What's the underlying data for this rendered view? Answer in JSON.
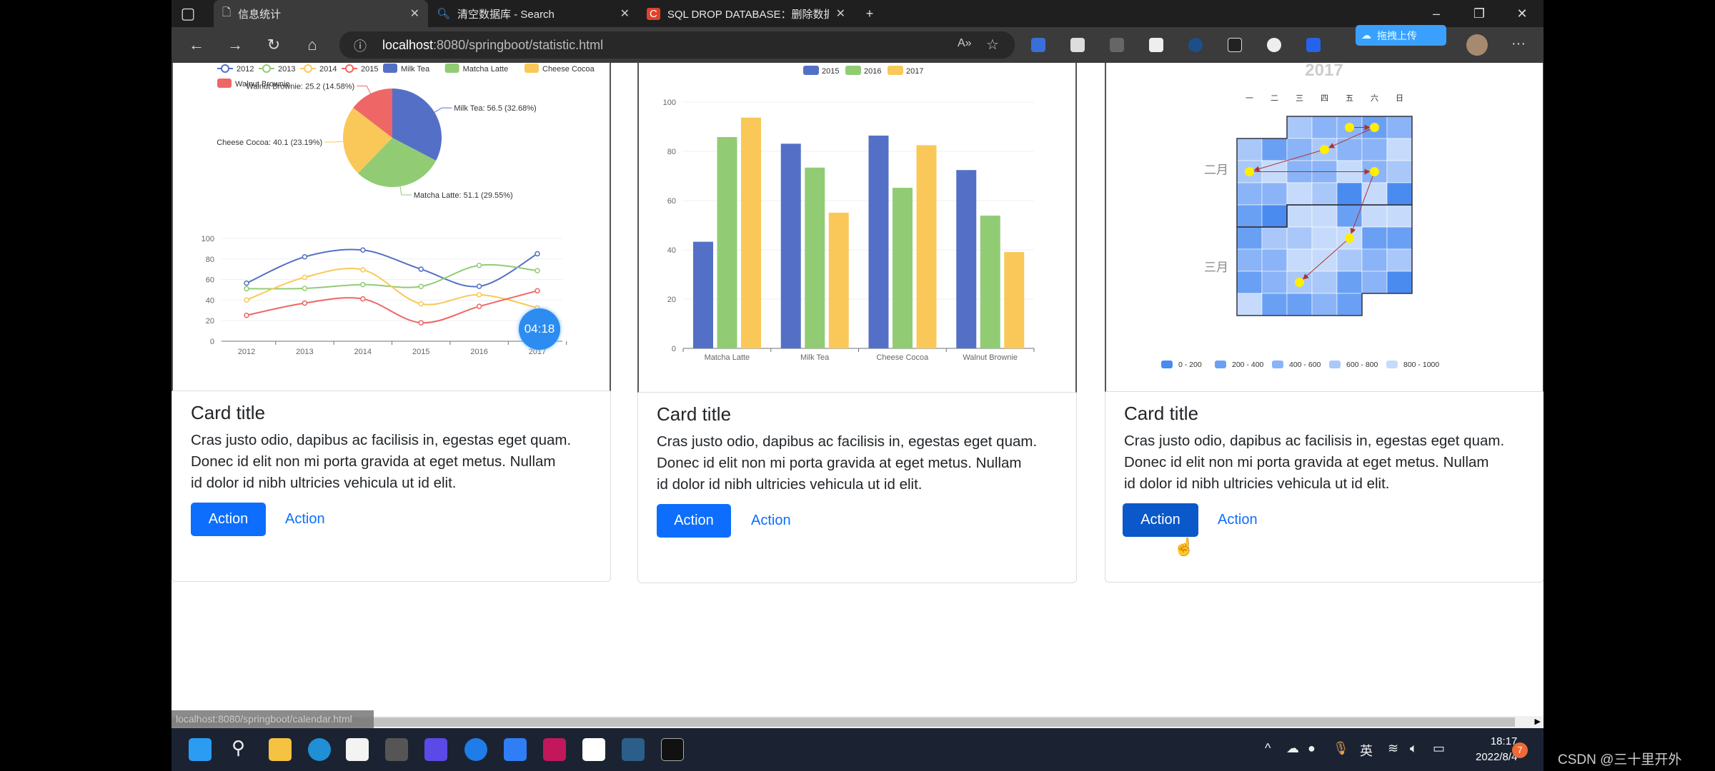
{
  "browser": {
    "tabs": [
      {
        "title": "信息统计",
        "active": true
      },
      {
        "title": "清空数据库 - Search",
        "active": false
      },
      {
        "title": "SQL DROP DATABASE：删除数据",
        "active": false
      }
    ],
    "url_host": "localhost",
    "url_rest": ":8080/springboot/statistic.html",
    "baidu_upload": "拖拽上传",
    "status_url": "localhost:8080/springboot/calendar.html"
  },
  "timer": "04:18",
  "cards": [
    {
      "title": "Card title",
      "text_lines": [
        "Cras justo odio, dapibus ac facilisis in, egestas eget quam.",
        "Donec id elit non mi porta gravida at eget metus. Nullam",
        "id dolor id nibh ultricies vehicula ut id elit."
      ],
      "primary": "Action",
      "link": "Action"
    },
    {
      "title": "Card title",
      "text_lines": [
        "Cras justo odio, dapibus ac facilisis in, egestas eget quam.",
        "Donec id elit non mi porta gravida at eget metus. Nullam",
        "id dolor id nibh ultricies vehicula ut id elit."
      ],
      "primary": "Action",
      "link": "Action"
    },
    {
      "title": "Card title",
      "text_lines": [
        "Cras justo odio, dapibus ac facilisis in, egestas eget quam.",
        "Donec id elit non mi porta gravida at eget metus. Nullam",
        "id dolor id nibh ultricies vehicula ut id elit."
      ],
      "primary": "Action",
      "link": "Action"
    }
  ],
  "chart_data": [
    {
      "type": "pie",
      "legend": [
        "2012",
        "2013",
        "2014",
        "2015",
        "Milk Tea",
        "Matcha Latte",
        "Cheese Cocoa",
        "Walnut Brownie"
      ],
      "categories": [
        "Milk Tea",
        "Matcha Latte",
        "Cheese Cocoa",
        "Walnut Brownie"
      ],
      "values": [
        56.5,
        51.1,
        40.1,
        25.2
      ],
      "labels": [
        "Milk Tea: 56.5 (32.68%)",
        "Matcha Latte: 51.1 (29.55%)",
        "Cheese Cocoa: 40.1 (23.19%)",
        "Walnut Brownie: 25.2 (14.58%)"
      ],
      "colors": [
        "#5470c6",
        "#91cc75",
        "#fac858",
        "#ee6666"
      ]
    },
    {
      "type": "line",
      "x": [
        "2012",
        "2013",
        "2014",
        "2015",
        "2016",
        "2017"
      ],
      "ylim": [
        0,
        100
      ],
      "yticks": [
        "0",
        "20",
        "40",
        "60",
        "80",
        "100"
      ],
      "smooth": true,
      "series": [
        {
          "name": "2012",
          "color": "#5470c6",
          "values": [
            56.5,
            82.1,
            88.7,
            70.1,
            53.4,
            85.1
          ]
        },
        {
          "name": "2013",
          "color": "#91cc75",
          "values": [
            51.1,
            51.4,
            55.1,
            53.3,
            73.8,
            68.7
          ]
        },
        {
          "name": "2014",
          "color": "#fac858",
          "values": [
            40.1,
            62.2,
            69.5,
            36.4,
            45.2,
            32.5
          ]
        },
        {
          "name": "2015",
          "color": "#ee6666",
          "values": [
            25.2,
            37.1,
            41.2,
            18.0,
            33.9,
            49.1
          ]
        }
      ]
    },
    {
      "type": "bar",
      "categories": [
        "Matcha Latte",
        "Milk Tea",
        "Cheese Cocoa",
        "Walnut Brownie"
      ],
      "ylim": [
        0,
        100
      ],
      "yticks": [
        "0",
        "20",
        "40",
        "60",
        "80",
        "100"
      ],
      "legend": "top",
      "series": [
        {
          "name": "2015",
          "color": "#5470c6",
          "values": [
            43.3,
            83.1,
            86.4,
            72.4
          ]
        },
        {
          "name": "2016",
          "color": "#91cc75",
          "values": [
            85.8,
            73.4,
            65.2,
            53.9
          ]
        },
        {
          "name": "2017",
          "color": "#fac858",
          "values": [
            93.7,
            55.1,
            82.5,
            39.1
          ]
        }
      ]
    },
    {
      "type": "heatmap",
      "title": "2017",
      "weekdays": [
        "一",
        "二",
        "三",
        "四",
        "五",
        "六",
        "日"
      ],
      "months": [
        "二月",
        "三月"
      ],
      "range": [
        "2017-02-01",
        "2017-03-31"
      ],
      "values": [
        700,
        500,
        450,
        300,
        500,
        700,
        300,
        450,
        650,
        500,
        520,
        850,
        650,
        850,
        480,
        420,
        880,
        460,
        700,
        550,
        500,
        820,
        720,
        100,
        860,
        150,
        300,
        180,
        900,
        880,
        350,
        920,
        900,
        320,
        750,
        700,
        850,
        830,
        280,
        330,
        520,
        480,
        880,
        900,
        650,
        550,
        680,
        300,
        500,
        620,
        700,
        340,
        560,
        120,
        870,
        330,
        300,
        450,
        360
      ],
      "legend": [
        "0 - 200",
        "200 - 400",
        "400 - 600",
        "600 - 800",
        "800 - 1000"
      ],
      "colors": [
        "#4a8bf0",
        "#6aa0f4",
        "#8ab4f7",
        "#a9c8f9",
        "#c6dbfb"
      ],
      "points": [
        "2017-02-03",
        "2017-02-04",
        "2017-02-09",
        "2017-02-13",
        "2017-02-18",
        "2017-03-10",
        "2017-03-22"
      ],
      "point_color": "#ffee00",
      "arrow_color": "#b03030"
    }
  ],
  "taskbar": {
    "time": "18:17",
    "date": "2022/8/4",
    "badge": "7",
    "ime": "英"
  },
  "watermark": "CSDN @三十里开外"
}
